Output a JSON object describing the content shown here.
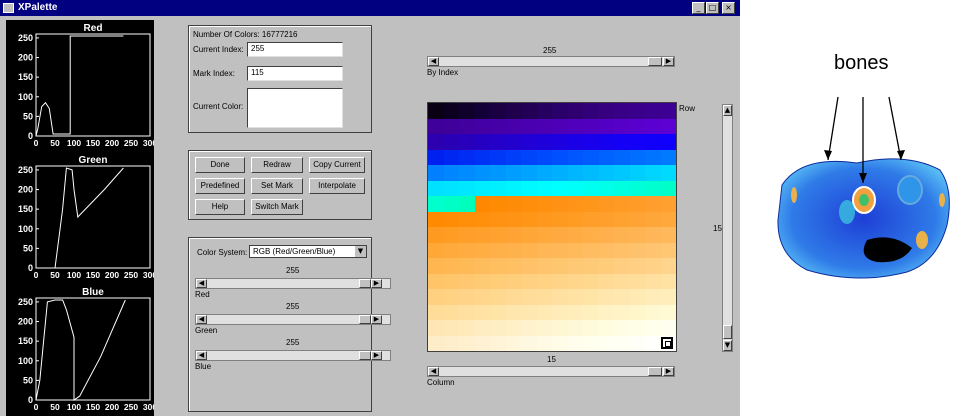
{
  "window": {
    "title": "XPalette"
  },
  "plots": [
    {
      "title": "Red",
      "yticks": [
        "250",
        "200",
        "150",
        "100",
        "50",
        "0"
      ],
      "xticks": [
        "0",
        "50",
        "100",
        "150",
        "200",
        "250",
        "300"
      ],
      "curve": [
        [
          0,
          0
        ],
        [
          5,
          20
        ],
        [
          15,
          75
        ],
        [
          25,
          85
        ],
        [
          35,
          70
        ],
        [
          45,
          5
        ],
        [
          90,
          5
        ],
        [
          90,
          255
        ],
        [
          230,
          255
        ]
      ]
    },
    {
      "title": "Green",
      "yticks": [
        "250",
        "200",
        "150",
        "100",
        "50",
        "0"
      ],
      "xticks": [
        "0",
        "50",
        "100",
        "150",
        "200",
        "250",
        "300"
      ],
      "curve": [
        [
          0,
          0
        ],
        [
          50,
          0
        ],
        [
          70,
          150
        ],
        [
          80,
          255
        ],
        [
          95,
          250
        ],
        [
          100,
          200
        ],
        [
          110,
          130
        ],
        [
          180,
          200
        ],
        [
          230,
          255
        ]
      ]
    },
    {
      "title": "Blue",
      "yticks": [
        "250",
        "200",
        "150",
        "100",
        "50",
        "0"
      ],
      "xticks": [
        "0",
        "50",
        "100",
        "150",
        "200",
        "250",
        "300"
      ],
      "curve": [
        [
          0,
          0
        ],
        [
          10,
          50
        ],
        [
          30,
          250
        ],
        [
          50,
          255
        ],
        [
          70,
          255
        ],
        [
          80,
          230
        ],
        [
          100,
          160
        ],
        [
          100,
          0
        ],
        [
          115,
          10
        ],
        [
          170,
          110
        ],
        [
          235,
          255
        ]
      ]
    }
  ],
  "info": {
    "num_colors": "Number Of Colors: 16777216",
    "current_index_label": "Current Index:",
    "current_index_value": "255",
    "mark_index_label": "Mark Index:",
    "mark_index_value": "115",
    "current_color_label": "Current Color:"
  },
  "buttons": {
    "done": "Done",
    "redraw": "Redraw",
    "copy_current": "Copy Current",
    "predefined": "Predefined",
    "set_mark": "Set Mark",
    "interpolate": "Interpolate",
    "help": "Help",
    "switch_mark": "Switch Mark"
  },
  "color_system": {
    "label": "Color System:",
    "value": "RGB  (Red/Green/Blue)",
    "sliders": [
      {
        "name": "Red",
        "value": "255",
        "level": 1.0
      },
      {
        "name": "Green",
        "value": "255",
        "level": 1.0
      },
      {
        "name": "Blue",
        "value": "255",
        "level": 1.0
      }
    ]
  },
  "palette_view": {
    "by_index_label": "By Index",
    "by_index_value": "255",
    "row_label": "Row",
    "row_value": "15",
    "column_label": "Column",
    "column_value": "15"
  },
  "figure": {
    "label": "bones"
  }
}
